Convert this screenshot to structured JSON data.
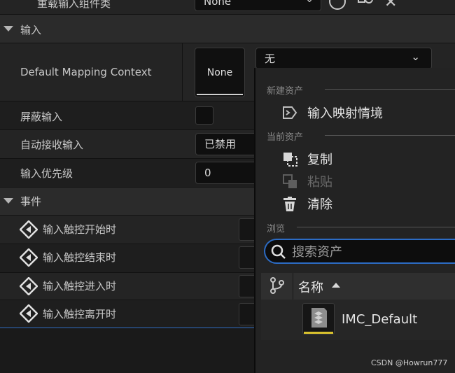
{
  "top_row": {
    "label": "重载输入组件类",
    "value": "None"
  },
  "input_category": {
    "title": "输入"
  },
  "mapping_context": {
    "label": "Default Mapping Context",
    "thumb_label": "None",
    "dropdown_value": "无"
  },
  "block_input": {
    "label": "屏蔽输入"
  },
  "auto_receive": {
    "label": "自动接收输入",
    "value": "已禁用"
  },
  "input_priority": {
    "label": "输入优先级",
    "value": "0"
  },
  "events_category": {
    "title": "事件",
    "items": [
      "输入触控开始时",
      "输入触控结束时",
      "输入触控进入时",
      "输入触控离开时"
    ]
  },
  "menu": {
    "new_asset_header": "新建资产",
    "new_asset_item": "输入映射情境",
    "current_asset_header": "当前资产",
    "copy": "复制",
    "paste": "粘贴",
    "clear": "清除",
    "browse_header": "浏览",
    "search_placeholder": "搜索资产",
    "column_name": "名称",
    "asset_name": "IMC_Default"
  },
  "watermark": "CSDN @Howrun777",
  "colors": {
    "accent_blue": "#2c6cc5",
    "asset_underline": "#d9c22e",
    "panel": "#242424"
  }
}
